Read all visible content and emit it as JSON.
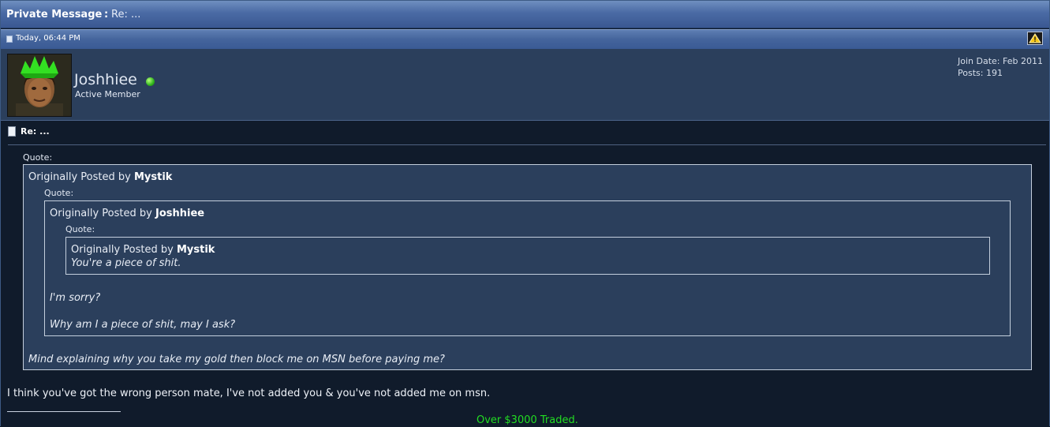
{
  "header": {
    "title_strong": "Private Message",
    "title_rest": "Re: ..."
  },
  "post": {
    "date": "Today, 06:44 PM",
    "subject": "Re: ..."
  },
  "user": {
    "name": "Joshhiee",
    "title": "Active Member",
    "join_date": "Join Date: Feb 2011",
    "posts": "Posts: 191",
    "online_color": "#2fb41c"
  },
  "quotes": {
    "label": "Quote:",
    "prefix": "Originally Posted by",
    "level1_author": "Mystik",
    "level2_author": "Joshhiee",
    "level3_author": "Mystik",
    "level3_text": "You're a piece of shit.",
    "level2_text_1": "I'm sorry?",
    "level2_text_2": "Why am I a piece of shit, may I ask?",
    "level1_text": "Mind explaining why you take my gold then block me on MSN before paying me?"
  },
  "message": "I think you've got the wrong person mate, I've not added you & you've not added me on msn.",
  "signature": "Over $3000 Traded.",
  "colors": {
    "signature": "#22dd22",
    "panel": "#2b3f5c",
    "background": "#101b2b"
  }
}
